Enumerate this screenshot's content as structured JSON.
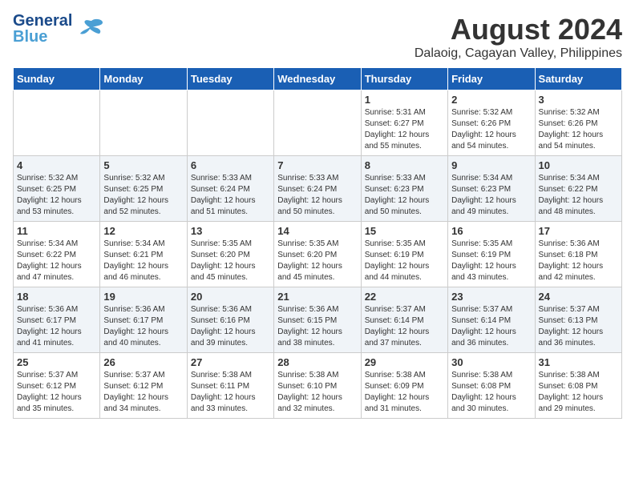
{
  "logo": {
    "general": "General",
    "blue": "Blue"
  },
  "header": {
    "title": "August 2024",
    "location": "Dalaoig, Cagayan Valley, Philippines"
  },
  "days_of_week": [
    "Sunday",
    "Monday",
    "Tuesday",
    "Wednesday",
    "Thursday",
    "Friday",
    "Saturday"
  ],
  "weeks": [
    [
      {
        "day": "",
        "info": ""
      },
      {
        "day": "",
        "info": ""
      },
      {
        "day": "",
        "info": ""
      },
      {
        "day": "",
        "info": ""
      },
      {
        "day": "1",
        "info": "Sunrise: 5:31 AM\nSunset: 6:27 PM\nDaylight: 12 hours\nand 55 minutes."
      },
      {
        "day": "2",
        "info": "Sunrise: 5:32 AM\nSunset: 6:26 PM\nDaylight: 12 hours\nand 54 minutes."
      },
      {
        "day": "3",
        "info": "Sunrise: 5:32 AM\nSunset: 6:26 PM\nDaylight: 12 hours\nand 54 minutes."
      }
    ],
    [
      {
        "day": "4",
        "info": "Sunrise: 5:32 AM\nSunset: 6:25 PM\nDaylight: 12 hours\nand 53 minutes."
      },
      {
        "day": "5",
        "info": "Sunrise: 5:32 AM\nSunset: 6:25 PM\nDaylight: 12 hours\nand 52 minutes."
      },
      {
        "day": "6",
        "info": "Sunrise: 5:33 AM\nSunset: 6:24 PM\nDaylight: 12 hours\nand 51 minutes."
      },
      {
        "day": "7",
        "info": "Sunrise: 5:33 AM\nSunset: 6:24 PM\nDaylight: 12 hours\nand 50 minutes."
      },
      {
        "day": "8",
        "info": "Sunrise: 5:33 AM\nSunset: 6:23 PM\nDaylight: 12 hours\nand 50 minutes."
      },
      {
        "day": "9",
        "info": "Sunrise: 5:34 AM\nSunset: 6:23 PM\nDaylight: 12 hours\nand 49 minutes."
      },
      {
        "day": "10",
        "info": "Sunrise: 5:34 AM\nSunset: 6:22 PM\nDaylight: 12 hours\nand 48 minutes."
      }
    ],
    [
      {
        "day": "11",
        "info": "Sunrise: 5:34 AM\nSunset: 6:22 PM\nDaylight: 12 hours\nand 47 minutes."
      },
      {
        "day": "12",
        "info": "Sunrise: 5:34 AM\nSunset: 6:21 PM\nDaylight: 12 hours\nand 46 minutes."
      },
      {
        "day": "13",
        "info": "Sunrise: 5:35 AM\nSunset: 6:20 PM\nDaylight: 12 hours\nand 45 minutes."
      },
      {
        "day": "14",
        "info": "Sunrise: 5:35 AM\nSunset: 6:20 PM\nDaylight: 12 hours\nand 45 minutes."
      },
      {
        "day": "15",
        "info": "Sunrise: 5:35 AM\nSunset: 6:19 PM\nDaylight: 12 hours\nand 44 minutes."
      },
      {
        "day": "16",
        "info": "Sunrise: 5:35 AM\nSunset: 6:19 PM\nDaylight: 12 hours\nand 43 minutes."
      },
      {
        "day": "17",
        "info": "Sunrise: 5:36 AM\nSunset: 6:18 PM\nDaylight: 12 hours\nand 42 minutes."
      }
    ],
    [
      {
        "day": "18",
        "info": "Sunrise: 5:36 AM\nSunset: 6:17 PM\nDaylight: 12 hours\nand 41 minutes."
      },
      {
        "day": "19",
        "info": "Sunrise: 5:36 AM\nSunset: 6:17 PM\nDaylight: 12 hours\nand 40 minutes."
      },
      {
        "day": "20",
        "info": "Sunrise: 5:36 AM\nSunset: 6:16 PM\nDaylight: 12 hours\nand 39 minutes."
      },
      {
        "day": "21",
        "info": "Sunrise: 5:36 AM\nSunset: 6:15 PM\nDaylight: 12 hours\nand 38 minutes."
      },
      {
        "day": "22",
        "info": "Sunrise: 5:37 AM\nSunset: 6:14 PM\nDaylight: 12 hours\nand 37 minutes."
      },
      {
        "day": "23",
        "info": "Sunrise: 5:37 AM\nSunset: 6:14 PM\nDaylight: 12 hours\nand 36 minutes."
      },
      {
        "day": "24",
        "info": "Sunrise: 5:37 AM\nSunset: 6:13 PM\nDaylight: 12 hours\nand 36 minutes."
      }
    ],
    [
      {
        "day": "25",
        "info": "Sunrise: 5:37 AM\nSunset: 6:12 PM\nDaylight: 12 hours\nand 35 minutes."
      },
      {
        "day": "26",
        "info": "Sunrise: 5:37 AM\nSunset: 6:12 PM\nDaylight: 12 hours\nand 34 minutes."
      },
      {
        "day": "27",
        "info": "Sunrise: 5:38 AM\nSunset: 6:11 PM\nDaylight: 12 hours\nand 33 minutes."
      },
      {
        "day": "28",
        "info": "Sunrise: 5:38 AM\nSunset: 6:10 PM\nDaylight: 12 hours\nand 32 minutes."
      },
      {
        "day": "29",
        "info": "Sunrise: 5:38 AM\nSunset: 6:09 PM\nDaylight: 12 hours\nand 31 minutes."
      },
      {
        "day": "30",
        "info": "Sunrise: 5:38 AM\nSunset: 6:08 PM\nDaylight: 12 hours\nand 30 minutes."
      },
      {
        "day": "31",
        "info": "Sunrise: 5:38 AM\nSunset: 6:08 PM\nDaylight: 12 hours\nand 29 minutes."
      }
    ]
  ]
}
